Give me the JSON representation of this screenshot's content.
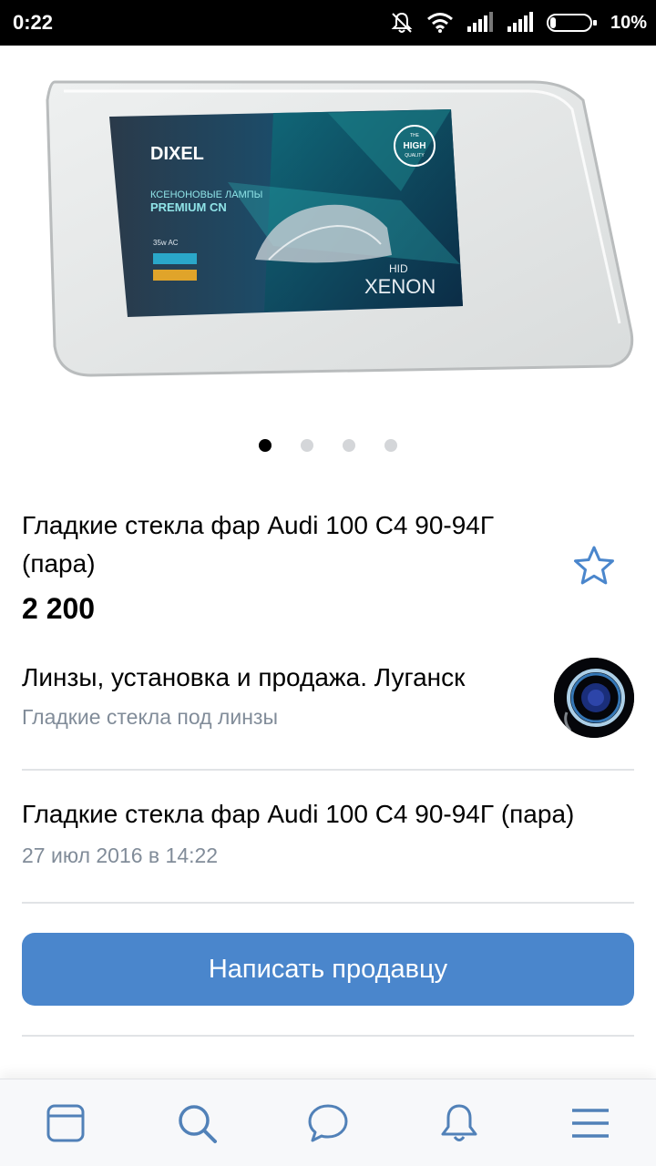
{
  "status_bar": {
    "time": "0:22",
    "battery": "10%",
    "icons": [
      "bell-muted-icon",
      "wifi-icon",
      "signal-icon",
      "signal-icon",
      "battery-icon"
    ]
  },
  "gallery": {
    "image_desc": "product-photo",
    "image_text": {
      "brand": "DIXEL",
      "line1": "КСЕНОНОВЫЕ ЛАМПЫ",
      "line2": "PREMIUM CN",
      "badge_small": "THE",
      "badge_main": "HIGH",
      "badge_small2": "QUALITY",
      "spec": "35w  AC",
      "logo": "XENON",
      "hid": "HID"
    },
    "dots_count": 4,
    "active_dot": 0
  },
  "product": {
    "title": "Гладкие стекла фар Audi 100 С4 90-94Г (пара)",
    "price": "2 200"
  },
  "seller": {
    "name": "Линзы, установка и продажа. Луганск",
    "subtitle": "Гладкие стекла под линзы"
  },
  "post": {
    "title": "Гладкие стекла фар Audi 100 С4 90-94Г (пара)",
    "date": "27 июл 2016 в 14:22"
  },
  "actions": {
    "contact_label": "Написать продавцу"
  },
  "colors": {
    "accent": "#4a86cc",
    "nav_icon": "#5181b8",
    "secondary_text": "#818c99"
  },
  "bottom_nav": [
    "news-icon",
    "search-icon",
    "messages-icon",
    "notifications-icon",
    "menu-icon"
  ]
}
